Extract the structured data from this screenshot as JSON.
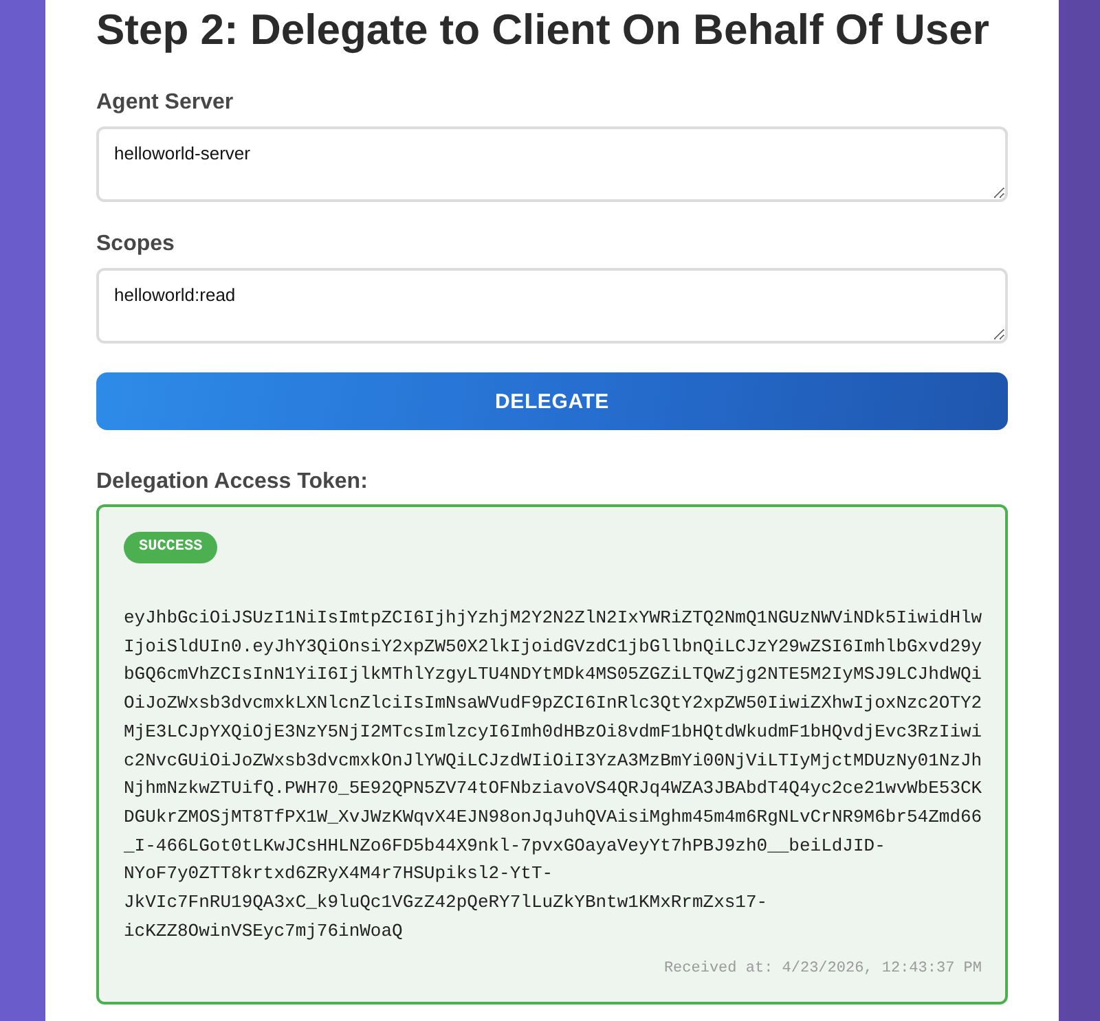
{
  "heading": "Step 2: Delegate to Client On Behalf Of User",
  "fields": [
    {
      "label": "Agent Server",
      "value": "helloworld-server"
    },
    {
      "label": "Scopes",
      "value": "helloworld:read"
    }
  ],
  "button": {
    "label": "DELEGATE"
  },
  "result": {
    "label": "Delegation Access Token:",
    "status": {
      "kind": "success",
      "label": "SUCCESS"
    },
    "token": "eyJhbGciOiJSUzI1NiIsImtpZCI6IjhjYzhjM2Y2N2ZlN2IxYWRiZTQ2NmQ1NGUzNWViNDk5IiwidHlwIjoiSldUIn0.eyJhY3QiOnsiY2xpZW50X2lkIjoidGVzdC1jbGllbnQiLCJzY29wZSI6ImhlbGxvd29ybGQ6cmVhZCIsInN1YiI6IjlkMThlYzgyLTU4NDYtMDk4MS05ZGZiLTQwZjg2NTE5M2IyMSJ9LCJhdWQiOiJoZWxsb3dvcmxkLXNlcnZlciIsImNsaWVudF9pZCI6InRlc3QtY2xpZW50IiwiZXhwIjoxNzc2OTY2MjE3LCJpYXQiOjE3NzY5NjI2MTcsImlzcyI6Imh0dHBzOi8vdmF1bHQtdWkudmF1bHQvdjEvc3RzIiwic2NvcGUiOiJoZWxsb3dvcmxkOnJlYWQiLCJzdWIiOiI3YzA3MzBmYi00NjViLTIyMjctMDUzNy01NzJhNjhmNzkwZTUifQ.PWH70_5E92QPN5ZV74tOFNbziavoVS4QRJq4WZA3JBAbdT4Q4yc2ce21wvWbE53CKDGUkrZMOSjMT8TfPX1W_XvJWzKWqvX4EJN98onJqJuhQVAisiMghm45m4m6RgNLvCrNR9M6br54Zmd66_I-466LGot0tLKwJCsHHLNZo6FD5b44X9nkl-7pvxGOayaVeyYt7hPBJ9zh0__beiLdJID-NYoF7y0ZTT8krtxd6ZRyX4M4r7HSUpiksl2-YtT-JkVIc7FnRU19QA3xC_k9luQc1VGzZ42pQeRY7lLuZkYBntw1KMxRrmZxs17-icKZZ8OwinVSEyc7mj76inWoaQ",
    "received": "Received at: 4/23/2026, 12:43:37 PM"
  }
}
